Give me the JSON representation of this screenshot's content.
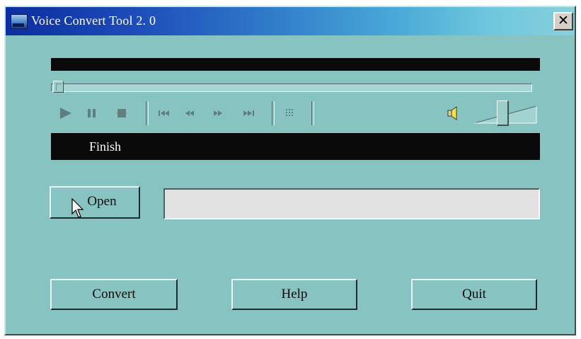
{
  "window": {
    "title": "Voice Convert Tool 2. 0",
    "close_label": "✕"
  },
  "player": {
    "icons": [
      "play-icon",
      "pause-icon",
      "stop-icon",
      "skip-back-icon",
      "rewind-icon",
      "fast-forward-icon",
      "skip-forward-icon",
      "grid-icon",
      "speaker-icon"
    ],
    "seek_position": 0.0,
    "volume_level": 0.55
  },
  "status": {
    "text": "Finish"
  },
  "file": {
    "open_label": "Open",
    "path_value": ""
  },
  "actions": {
    "convert_label": "Convert",
    "help_label": "Help",
    "quit_label": "Quit"
  },
  "colors": {
    "window_bg": "#87c3c1",
    "title_start": "#0c2ea0",
    "title_end": "#86d0dc",
    "display_bg": "#0a0a0a"
  }
}
